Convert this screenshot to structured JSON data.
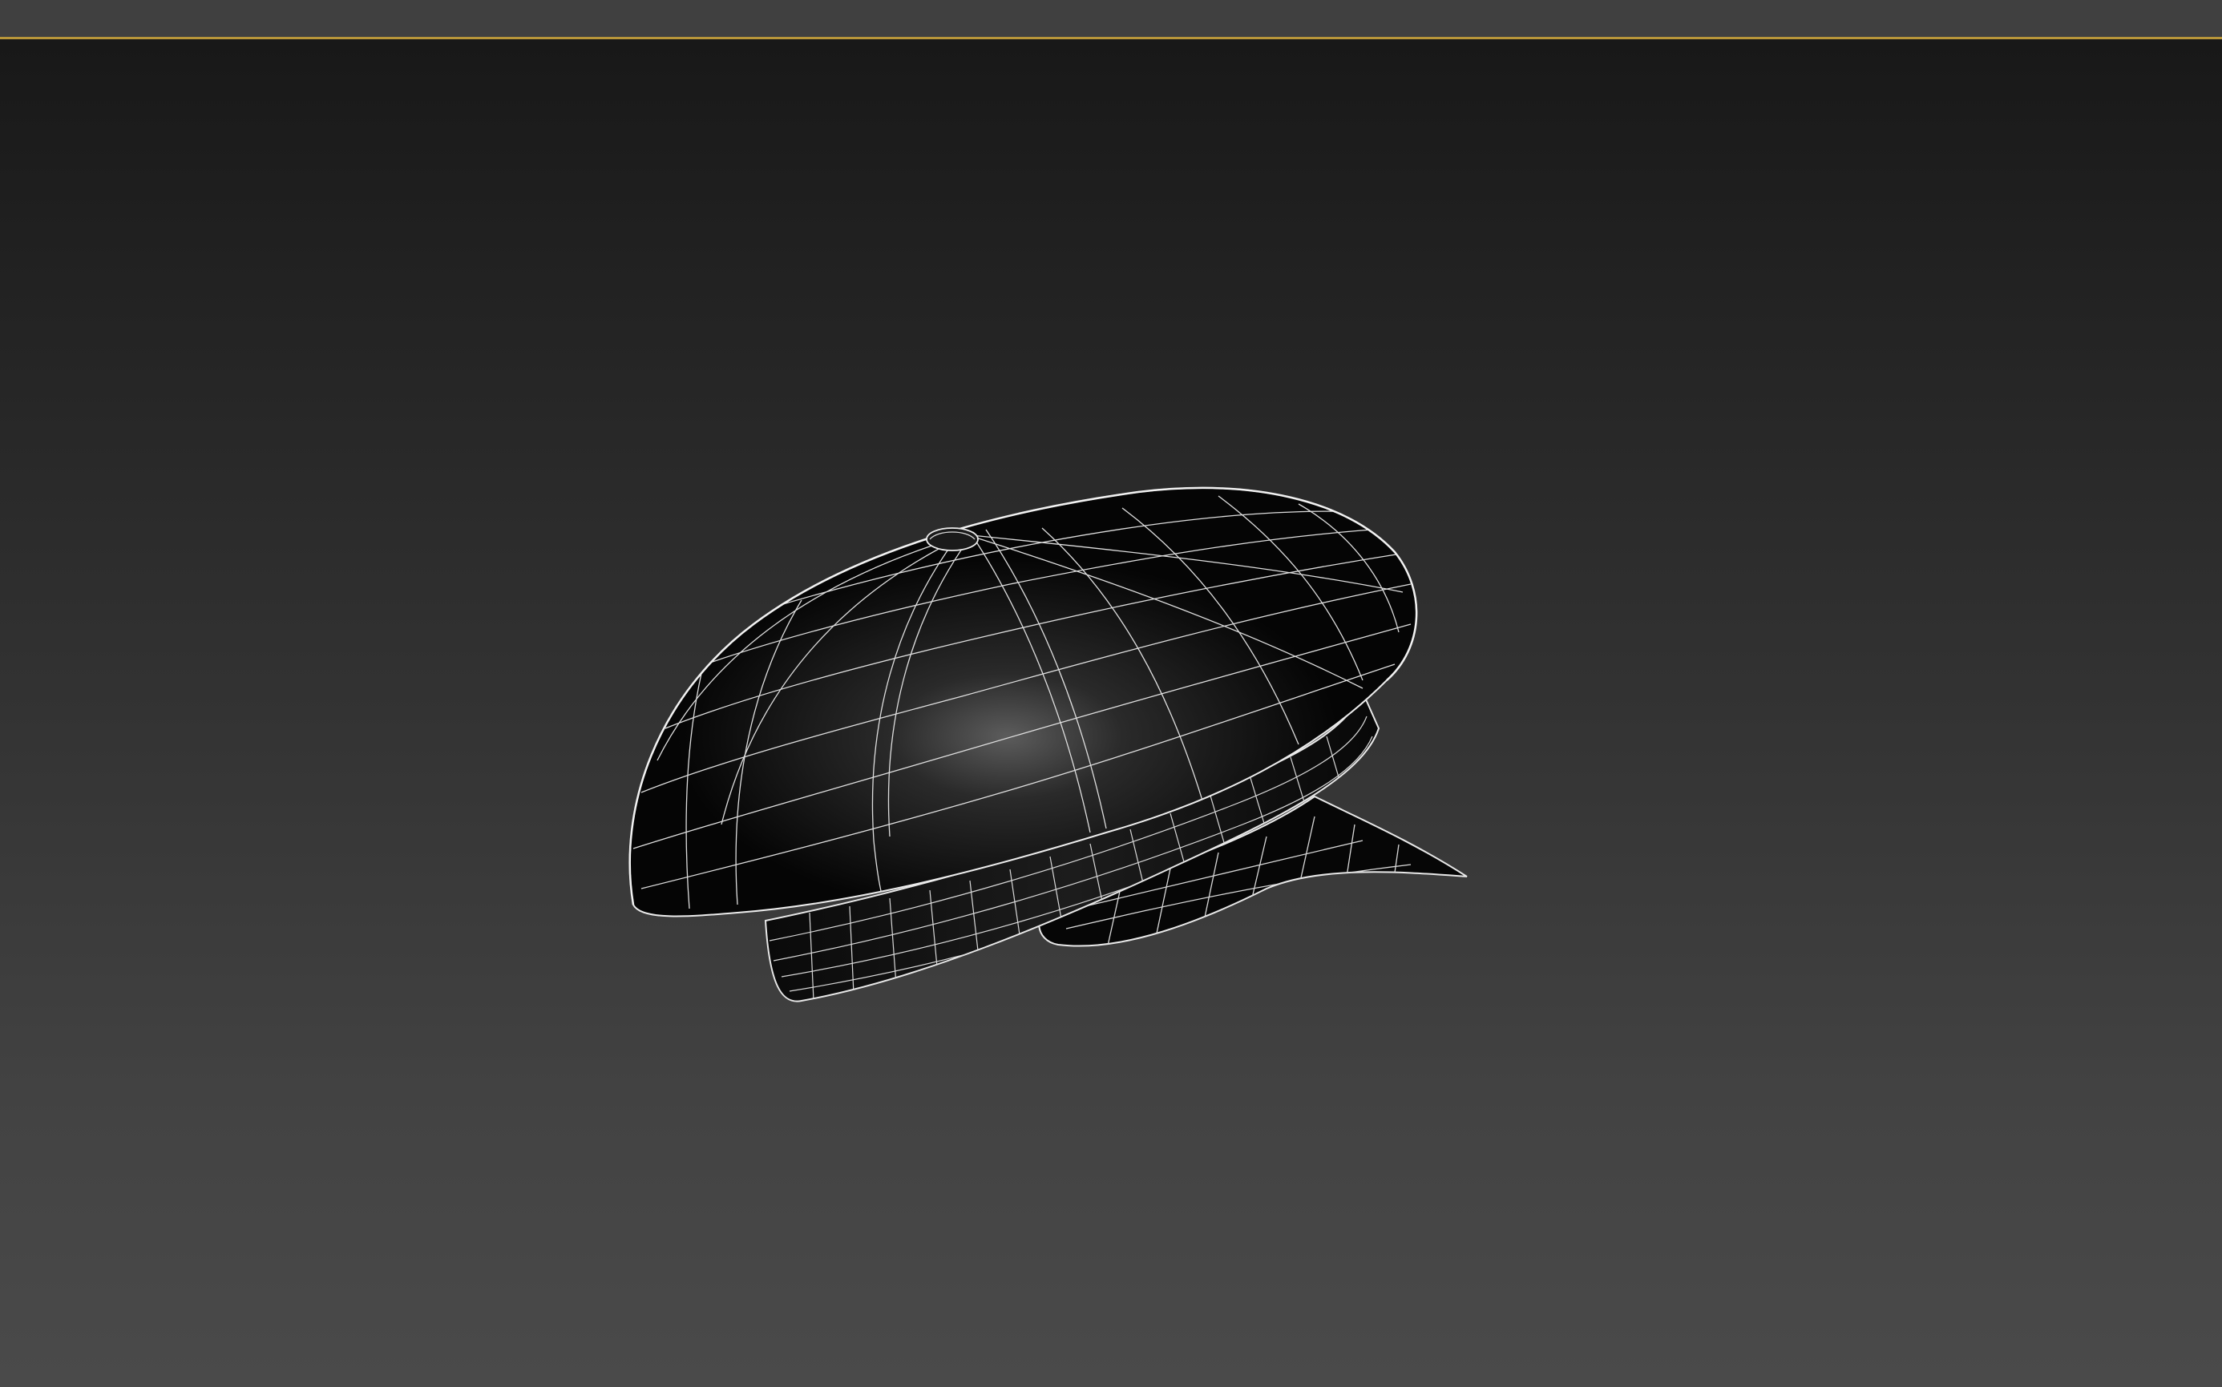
{
  "window": {
    "title": ""
  },
  "viewport": {
    "label": "",
    "active_border_color": "#b8963a",
    "background_top_color": "#181818",
    "background_bottom_color": "#4a4a4a",
    "display_mode": "wireframe-over-shaded"
  },
  "scene": {
    "object_type": "newsboy-cap",
    "wireframe_color": "#f0f0f0",
    "shaded_color": "#050505",
    "highlight_color": "#5a5a5a"
  }
}
